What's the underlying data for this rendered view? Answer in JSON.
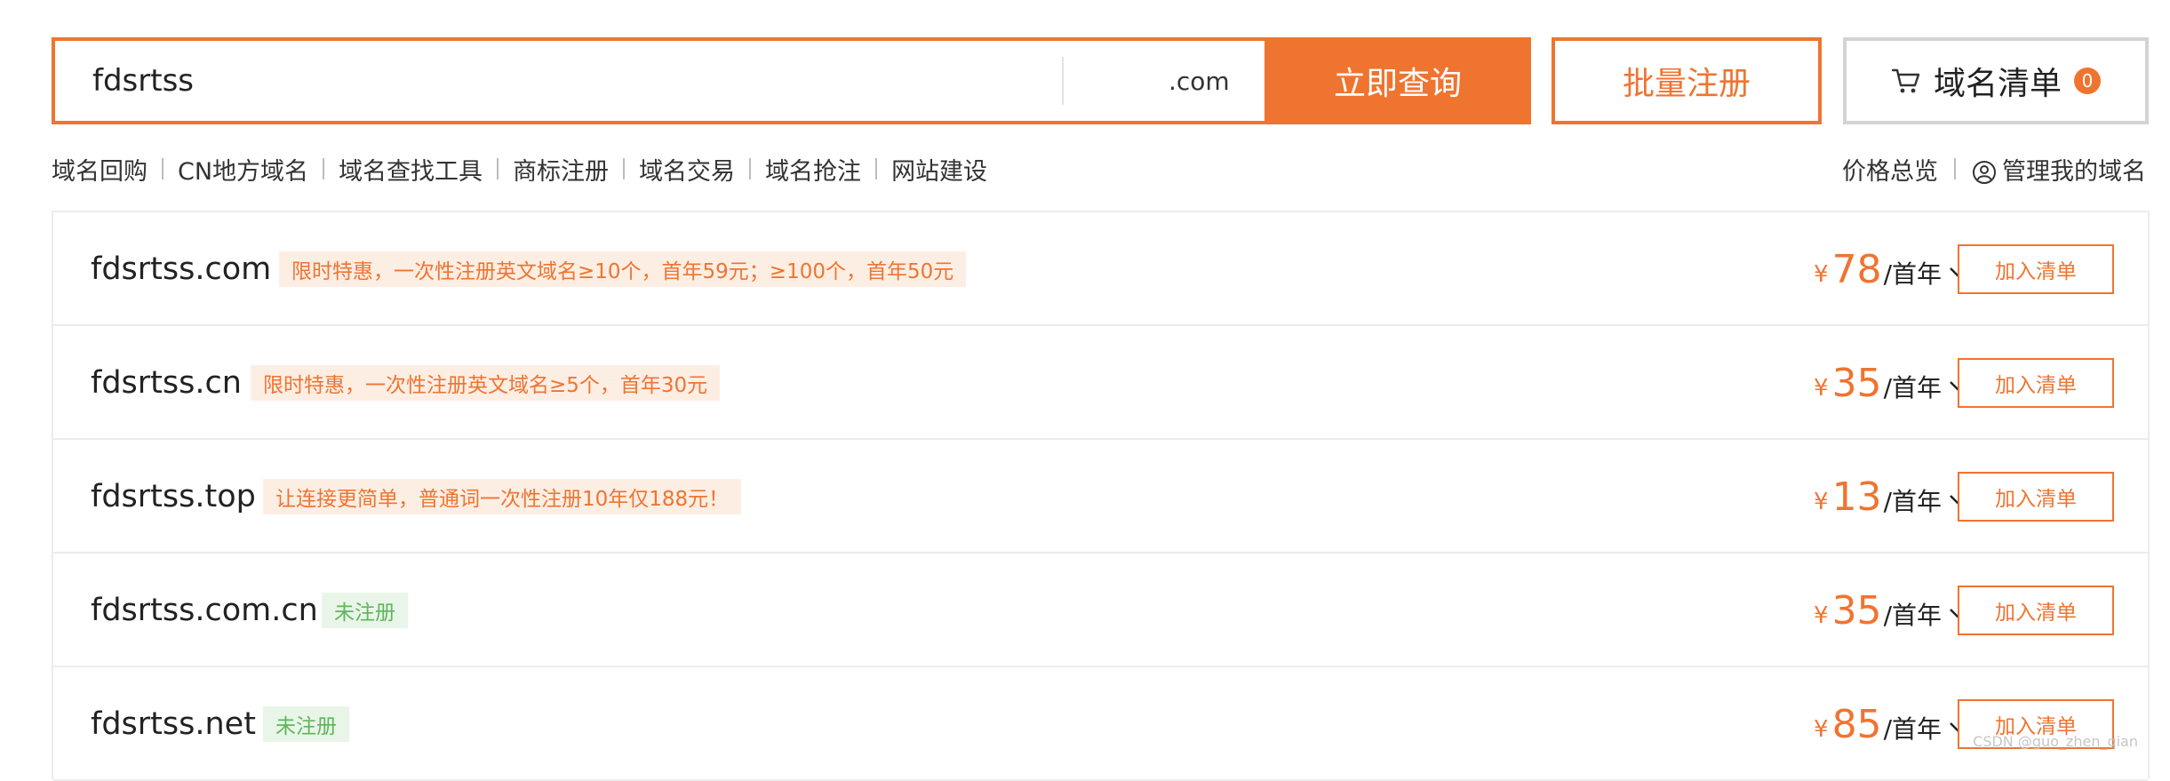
{
  "search": {
    "query": "fdsrtss",
    "tld_selected": ".com",
    "search_button": "立即查询",
    "bulk_button": "批量注册",
    "cart_label": "域名清单",
    "cart_count": "0"
  },
  "subnav": {
    "left": [
      "域名回购",
      "CN地方域名",
      "域名查找工具",
      "商标注册",
      "域名交易",
      "域名抢注",
      "网站建设"
    ],
    "price_overview": "价格总览",
    "manage_domains": "管理我的域名"
  },
  "results": [
    {
      "domain": "fdsrtss.com",
      "tag": "限时特惠，一次性注册英文域名≥10个，首年59元；≥100个，首年50元",
      "tag_style": "promo",
      "currency": "¥",
      "price": "78",
      "unit": "/首年",
      "button": "加入清单"
    },
    {
      "domain": "fdsrtss.cn",
      "tag": "限时特惠，一次性注册英文域名≥5个，首年30元",
      "tag_style": "promo",
      "currency": "¥",
      "price": "35",
      "unit": "/首年",
      "button": "加入清单"
    },
    {
      "domain": "fdsrtss.top",
      "tag": "让连接更简单，普通词一次性注册10年仅188元！",
      "tag_style": "promo",
      "currency": "¥",
      "price": "13",
      "unit": "/首年",
      "button": "加入清单"
    },
    {
      "domain": "fdsrtss.com.cn",
      "tag": "未注册",
      "tag_style": "status",
      "currency": "¥",
      "price": "35",
      "unit": "/首年",
      "button": "加入清单"
    },
    {
      "domain": "fdsrtss.net",
      "tag": "未注册",
      "tag_style": "status",
      "currency": "¥",
      "price": "85",
      "unit": "/首年",
      "button": "加入清单"
    }
  ],
  "watermark": "CSDN @guo_zhen_qian",
  "colors": {
    "accent": "#ef7430",
    "promo_bg": "#fdeee4",
    "status_green": "#5fb55b",
    "status_bg": "#e9f5e8",
    "border": "#ececec"
  }
}
